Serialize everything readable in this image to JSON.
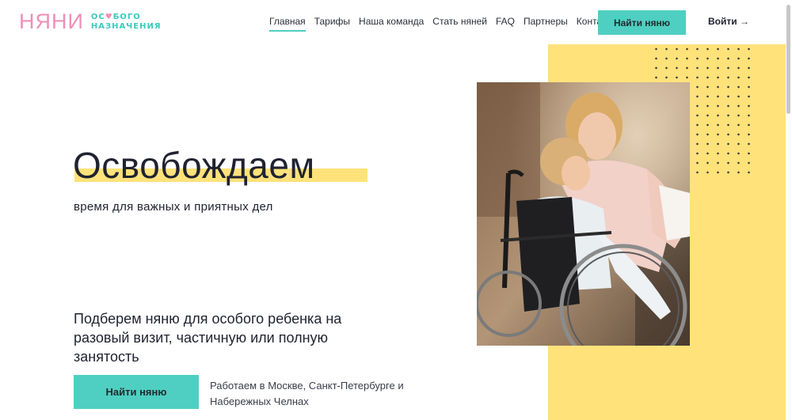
{
  "header": {
    "logo_main": "НЯНИ",
    "logo_sub_line1_a": "ОС",
    "logo_sub_line1_b": "БОГО",
    "logo_sub_line2": "НАЗНАЧЕНИЯ",
    "nav": [
      {
        "label": "Главная",
        "active": true
      },
      {
        "label": "Тарифы"
      },
      {
        "label": "Наша команда"
      },
      {
        "label": "Стать няней"
      },
      {
        "label": "FAQ"
      },
      {
        "label": "Партнеры"
      },
      {
        "label": "Контакты"
      }
    ],
    "cta_label": "Найти няню",
    "login_label": "Войти →"
  },
  "hero": {
    "title": "Освобождаем",
    "subtitle": "время для важных и приятных дел",
    "lead": "Подберем няню для особого ребенка на разовый визит, частичную или полную занятость",
    "cta_label": "Найти няню",
    "cities": "Работаем в Москве, Санкт-Петербурге и Набережных Челнах"
  },
  "colors": {
    "accent_teal": "#4fcfc1",
    "accent_pink": "#ee8fb7",
    "accent_yellow": "#ffe27a"
  }
}
